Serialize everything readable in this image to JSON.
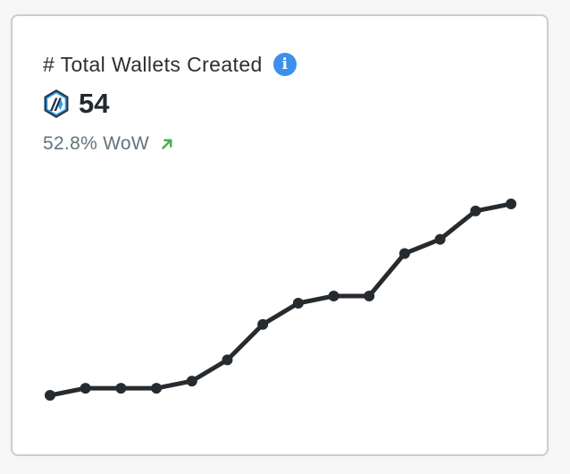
{
  "widget": {
    "title": "# Total Wallets Created",
    "info_icon": "info-icon",
    "logo_icon": "arbitrum-logo-icon",
    "value": "54",
    "change_text": "52.8% WoW",
    "change_direction": "up",
    "arrow_icon": "arrow-up-right-icon"
  },
  "colors": {
    "line": "#262b2f",
    "info": "#3d8fe9",
    "trend_up": "#4caf50",
    "secondary_text": "#62737d"
  },
  "chart_data": {
    "type": "line",
    "title": "",
    "xlabel": "",
    "ylabel": "",
    "markers": true,
    "grid": false,
    "axes_visible": false,
    "series": [
      {
        "values": [
          1,
          3,
          3,
          3,
          5,
          11,
          21,
          27,
          29,
          29,
          41,
          45,
          53,
          55
        ]
      }
    ]
  }
}
